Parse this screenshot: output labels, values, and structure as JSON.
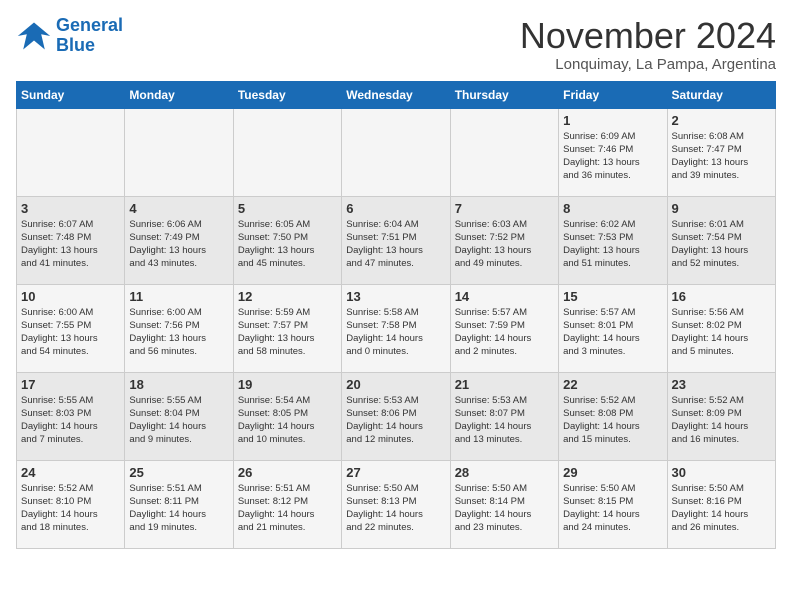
{
  "header": {
    "logo_line1": "General",
    "logo_line2": "Blue",
    "month_title": "November 2024",
    "location": "Lonquimay, La Pampa, Argentina"
  },
  "weekdays": [
    "Sunday",
    "Monday",
    "Tuesday",
    "Wednesday",
    "Thursday",
    "Friday",
    "Saturday"
  ],
  "weeks": [
    [
      {
        "day": "",
        "info": ""
      },
      {
        "day": "",
        "info": ""
      },
      {
        "day": "",
        "info": ""
      },
      {
        "day": "",
        "info": ""
      },
      {
        "day": "",
        "info": ""
      },
      {
        "day": "1",
        "info": "Sunrise: 6:09 AM\nSunset: 7:46 PM\nDaylight: 13 hours\nand 36 minutes."
      },
      {
        "day": "2",
        "info": "Sunrise: 6:08 AM\nSunset: 7:47 PM\nDaylight: 13 hours\nand 39 minutes."
      }
    ],
    [
      {
        "day": "3",
        "info": "Sunrise: 6:07 AM\nSunset: 7:48 PM\nDaylight: 13 hours\nand 41 minutes."
      },
      {
        "day": "4",
        "info": "Sunrise: 6:06 AM\nSunset: 7:49 PM\nDaylight: 13 hours\nand 43 minutes."
      },
      {
        "day": "5",
        "info": "Sunrise: 6:05 AM\nSunset: 7:50 PM\nDaylight: 13 hours\nand 45 minutes."
      },
      {
        "day": "6",
        "info": "Sunrise: 6:04 AM\nSunset: 7:51 PM\nDaylight: 13 hours\nand 47 minutes."
      },
      {
        "day": "7",
        "info": "Sunrise: 6:03 AM\nSunset: 7:52 PM\nDaylight: 13 hours\nand 49 minutes."
      },
      {
        "day": "8",
        "info": "Sunrise: 6:02 AM\nSunset: 7:53 PM\nDaylight: 13 hours\nand 51 minutes."
      },
      {
        "day": "9",
        "info": "Sunrise: 6:01 AM\nSunset: 7:54 PM\nDaylight: 13 hours\nand 52 minutes."
      }
    ],
    [
      {
        "day": "10",
        "info": "Sunrise: 6:00 AM\nSunset: 7:55 PM\nDaylight: 13 hours\nand 54 minutes."
      },
      {
        "day": "11",
        "info": "Sunrise: 6:00 AM\nSunset: 7:56 PM\nDaylight: 13 hours\nand 56 minutes."
      },
      {
        "day": "12",
        "info": "Sunrise: 5:59 AM\nSunset: 7:57 PM\nDaylight: 13 hours\nand 58 minutes."
      },
      {
        "day": "13",
        "info": "Sunrise: 5:58 AM\nSunset: 7:58 PM\nDaylight: 14 hours\nand 0 minutes."
      },
      {
        "day": "14",
        "info": "Sunrise: 5:57 AM\nSunset: 7:59 PM\nDaylight: 14 hours\nand 2 minutes."
      },
      {
        "day": "15",
        "info": "Sunrise: 5:57 AM\nSunset: 8:01 PM\nDaylight: 14 hours\nand 3 minutes."
      },
      {
        "day": "16",
        "info": "Sunrise: 5:56 AM\nSunset: 8:02 PM\nDaylight: 14 hours\nand 5 minutes."
      }
    ],
    [
      {
        "day": "17",
        "info": "Sunrise: 5:55 AM\nSunset: 8:03 PM\nDaylight: 14 hours\nand 7 minutes."
      },
      {
        "day": "18",
        "info": "Sunrise: 5:55 AM\nSunset: 8:04 PM\nDaylight: 14 hours\nand 9 minutes."
      },
      {
        "day": "19",
        "info": "Sunrise: 5:54 AM\nSunset: 8:05 PM\nDaylight: 14 hours\nand 10 minutes."
      },
      {
        "day": "20",
        "info": "Sunrise: 5:53 AM\nSunset: 8:06 PM\nDaylight: 14 hours\nand 12 minutes."
      },
      {
        "day": "21",
        "info": "Sunrise: 5:53 AM\nSunset: 8:07 PM\nDaylight: 14 hours\nand 13 minutes."
      },
      {
        "day": "22",
        "info": "Sunrise: 5:52 AM\nSunset: 8:08 PM\nDaylight: 14 hours\nand 15 minutes."
      },
      {
        "day": "23",
        "info": "Sunrise: 5:52 AM\nSunset: 8:09 PM\nDaylight: 14 hours\nand 16 minutes."
      }
    ],
    [
      {
        "day": "24",
        "info": "Sunrise: 5:52 AM\nSunset: 8:10 PM\nDaylight: 14 hours\nand 18 minutes."
      },
      {
        "day": "25",
        "info": "Sunrise: 5:51 AM\nSunset: 8:11 PM\nDaylight: 14 hours\nand 19 minutes."
      },
      {
        "day": "26",
        "info": "Sunrise: 5:51 AM\nSunset: 8:12 PM\nDaylight: 14 hours\nand 21 minutes."
      },
      {
        "day": "27",
        "info": "Sunrise: 5:50 AM\nSunset: 8:13 PM\nDaylight: 14 hours\nand 22 minutes."
      },
      {
        "day": "28",
        "info": "Sunrise: 5:50 AM\nSunset: 8:14 PM\nDaylight: 14 hours\nand 23 minutes."
      },
      {
        "day": "29",
        "info": "Sunrise: 5:50 AM\nSunset: 8:15 PM\nDaylight: 14 hours\nand 24 minutes."
      },
      {
        "day": "30",
        "info": "Sunrise: 5:50 AM\nSunset: 8:16 PM\nDaylight: 14 hours\nand 26 minutes."
      }
    ]
  ]
}
